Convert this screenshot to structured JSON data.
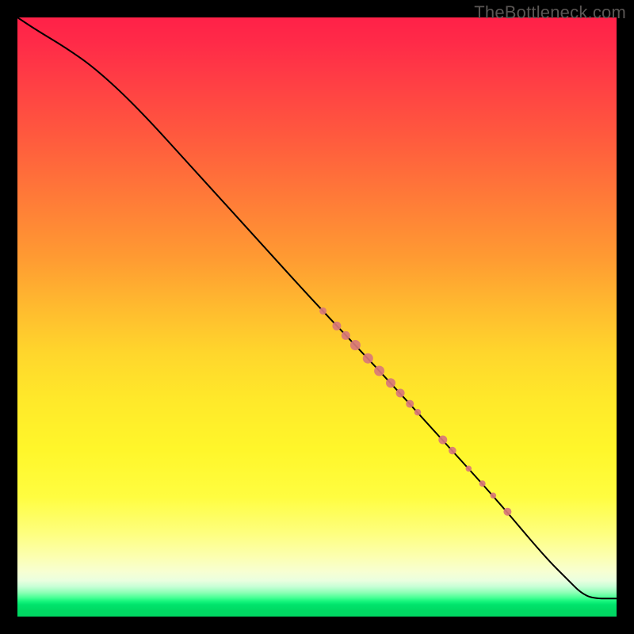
{
  "watermark": "TheBottleneck.com",
  "colors": {
    "dot": "#d97878",
    "curve": "#000000"
  },
  "chart_data": {
    "type": "line",
    "title": "",
    "xlabel": "",
    "ylabel": "",
    "xlim": [
      0,
      100
    ],
    "ylim": [
      0,
      100
    ],
    "grid": false,
    "series": [
      {
        "name": "curve",
        "x": [
          0,
          3,
          8,
          13,
          20,
          30,
          40,
          50,
          60,
          70,
          80,
          88,
          92,
          94,
          96,
          100
        ],
        "y": [
          100,
          98,
          95,
          91.5,
          85,
          74,
          63,
          52,
          41.5,
          30.5,
          19.5,
          10,
          6,
          4,
          3,
          3
        ]
      }
    ],
    "points": [
      {
        "x": 51.0,
        "y": 51.0,
        "r": 4.5
      },
      {
        "x": 53.3,
        "y": 48.5,
        "r": 5.5
      },
      {
        "x": 54.8,
        "y": 46.9,
        "r": 5.5
      },
      {
        "x": 56.4,
        "y": 45.3,
        "r": 6.5
      },
      {
        "x": 58.5,
        "y": 43.1,
        "r": 6.5
      },
      {
        "x": 60.4,
        "y": 41.0,
        "r": 6.5
      },
      {
        "x": 62.3,
        "y": 39.0,
        "r": 6.0
      },
      {
        "x": 63.9,
        "y": 37.3,
        "r": 5.5
      },
      {
        "x": 65.5,
        "y": 35.5,
        "r": 5.0
      },
      {
        "x": 66.8,
        "y": 34.1,
        "r": 4.2
      },
      {
        "x": 71.0,
        "y": 29.5,
        "r": 5.5
      },
      {
        "x": 72.6,
        "y": 27.7,
        "r": 4.8
      },
      {
        "x": 75.3,
        "y": 24.7,
        "r": 3.8
      },
      {
        "x": 77.6,
        "y": 22.2,
        "r": 4.0
      },
      {
        "x": 79.4,
        "y": 20.2,
        "r": 3.8
      },
      {
        "x": 81.8,
        "y": 17.5,
        "r": 5.0
      }
    ]
  }
}
